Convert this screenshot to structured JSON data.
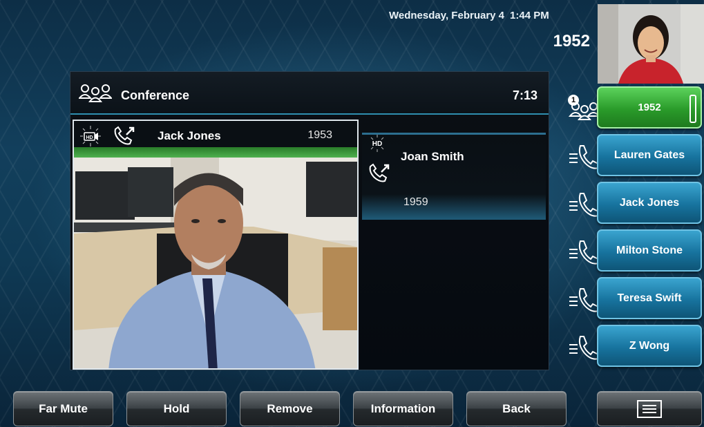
{
  "status": {
    "date": "Wednesday, February 4",
    "time": "1:44 PM",
    "extension": "1952"
  },
  "conference": {
    "title": "Conference",
    "timer": "7:13",
    "participants": [
      {
        "name": "Jack Jones",
        "number": "1953",
        "hd": "HD"
      },
      {
        "name": "Joan Smith",
        "number": "1959",
        "hd": "HD"
      }
    ]
  },
  "line_keys": [
    {
      "label": "1952",
      "active": true,
      "badge": "1"
    },
    {
      "label": "Lauren Gates"
    },
    {
      "label": "Jack Jones"
    },
    {
      "label": "Milton Stone"
    },
    {
      "label": "Teresa Swift"
    },
    {
      "label": "Z Wong"
    }
  ],
  "softkeys": [
    "Far Mute",
    "Hold",
    "Remove",
    "Information",
    "Back"
  ],
  "icons": {
    "conference": "conference-people-icon",
    "call": "handset-active-call-icon",
    "line": "handset-line-icon",
    "menu": "menu-list-icon"
  },
  "colors": {
    "active_line": "#2a9b2a",
    "line_key": "#17739e",
    "accent": "#2f8fb0"
  }
}
